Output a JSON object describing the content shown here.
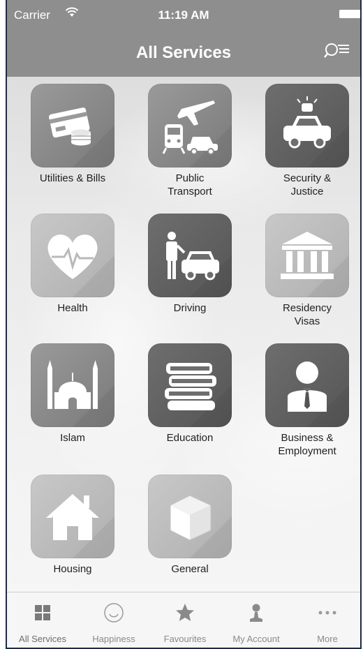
{
  "status": {
    "carrier": "Carrier",
    "time": "11:19 AM"
  },
  "header": {
    "title": "All Services"
  },
  "services": [
    {
      "label": "Utilities & Bills",
      "icon": "bill-payment-icon"
    },
    {
      "label": "Public\nTransport",
      "icon": "public-transport-icon"
    },
    {
      "label": "Security &\nJustice",
      "icon": "police-car-icon"
    },
    {
      "label": "Health",
      "icon": "heart-pulse-icon"
    },
    {
      "label": "Driving",
      "icon": "driver-car-icon"
    },
    {
      "label": "Residency\nVisas",
      "icon": "government-building-icon"
    },
    {
      "label": "Islam",
      "icon": "mosque-icon"
    },
    {
      "label": "Education",
      "icon": "books-icon"
    },
    {
      "label": "Business &\nEmployment",
      "icon": "businessman-icon"
    },
    {
      "label": "Housing",
      "icon": "house-icon"
    },
    {
      "label": "General",
      "icon": "cube-icon"
    }
  ],
  "tabs": [
    {
      "label": "All Services",
      "icon": "grid-icon",
      "active": true
    },
    {
      "label": "Happiness",
      "icon": "smiley-icon",
      "active": false
    },
    {
      "label": "Favourites",
      "icon": "star-icon",
      "active": false
    },
    {
      "label": "My Account",
      "icon": "user-icon",
      "active": false
    },
    {
      "label": "More",
      "icon": "more-dots-icon",
      "active": false
    }
  ],
  "colors": {
    "header_bg": "#8e8e8e",
    "tile_bg": "#8a8a8a",
    "tabbar_bg": "#f6f6f6"
  }
}
